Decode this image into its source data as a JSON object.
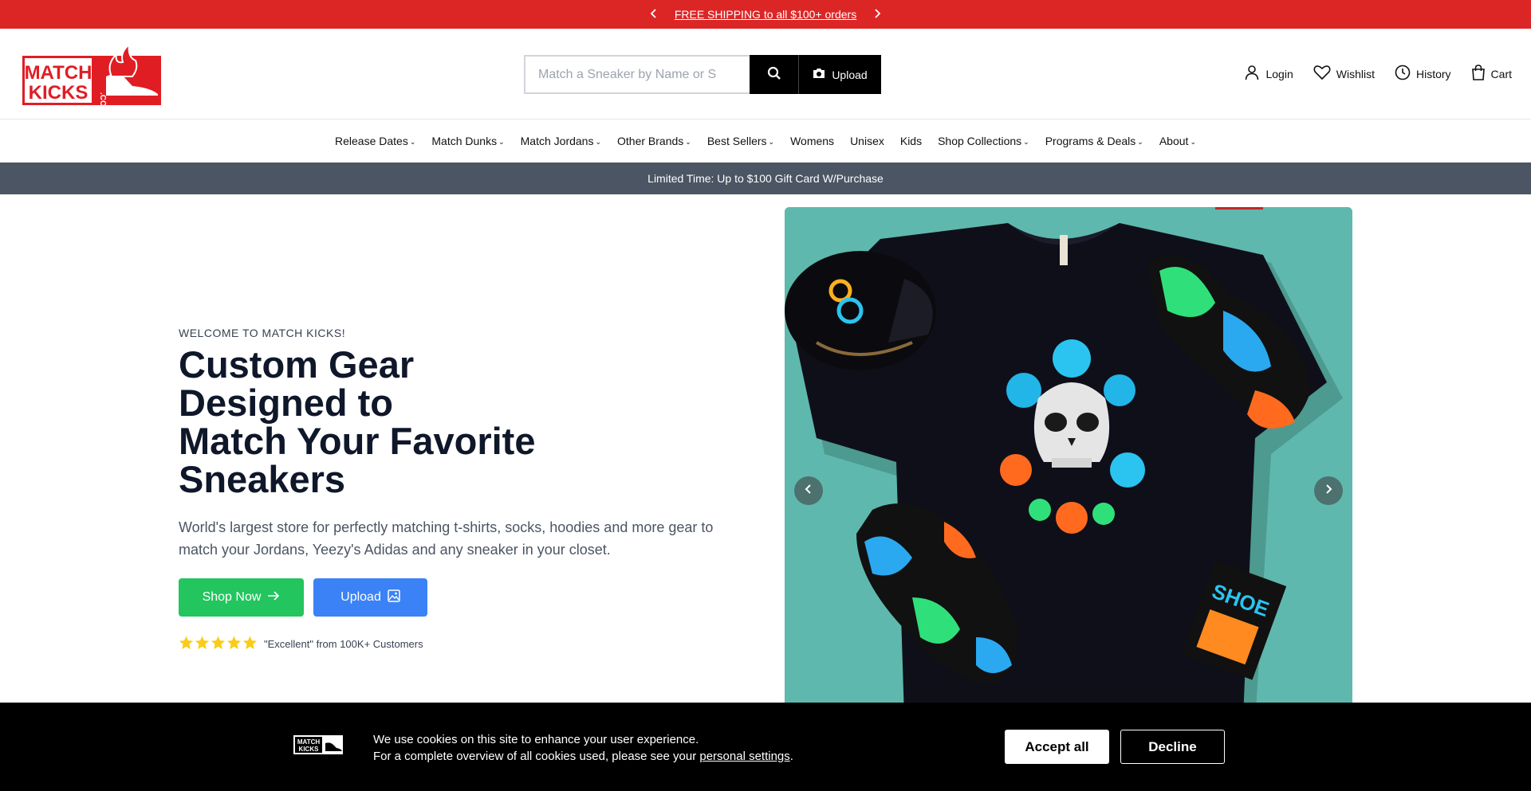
{
  "announcement": {
    "text": "FREE SHIPPING to all $100+ orders",
    "prev_icon": "chevron-left-icon",
    "next_icon": "chevron-right-icon",
    "bg_color": "#dc2626"
  },
  "header": {
    "logo": {
      "line1": "MATCH",
      "line2": "KICKS",
      "suffix": ".COM"
    },
    "search": {
      "placeholder": "Match a Sneaker by Name or S",
      "value": "",
      "upload_label": "Upload"
    },
    "account": [
      {
        "label": "Login",
        "icon": "user-icon"
      },
      {
        "label": "Wishlist",
        "icon": "heart-icon"
      },
      {
        "label": "History",
        "icon": "clock-icon"
      },
      {
        "label": "Cart",
        "icon": "bag-icon"
      }
    ]
  },
  "nav": {
    "items": [
      {
        "label": "Release Dates",
        "dropdown": true
      },
      {
        "label": "Match Dunks",
        "dropdown": true
      },
      {
        "label": "Match Jordans",
        "dropdown": true
      },
      {
        "label": "Other Brands",
        "dropdown": true
      },
      {
        "label": "Best Sellers",
        "dropdown": true
      },
      {
        "label": "Womens",
        "dropdown": false
      },
      {
        "label": "Unisex",
        "dropdown": false
      },
      {
        "label": "Kids",
        "dropdown": false
      },
      {
        "label": "Shop Collections",
        "dropdown": true
      },
      {
        "label": "Programs & Deals",
        "dropdown": true
      },
      {
        "label": "About",
        "dropdown": true
      }
    ]
  },
  "promo": {
    "text": "Limited Time: Up to $100 Gift Card W/Purchase",
    "bg_color": "#4b5563"
  },
  "hero": {
    "eyebrow": "WELCOME TO MATCH KICKS!",
    "title_lines": [
      "Custom Gear",
      "Designed to",
      "Match Your Favorite",
      "Sneakers"
    ],
    "description": "World's largest store for perfectly matching t-shirts, socks, hoodies and more gear to match your Jordans, Yeezy's Adidas and any sneaker in your closet.",
    "shop_now_label": "Shop Now",
    "upload_label": "Upload",
    "rating_text": "\"Excellent\" from 100K+ Customers",
    "rating_stars": 5,
    "colors": {
      "shop_now": "#22c55e",
      "upload": "#3b82f6",
      "stars": "#facc15"
    }
  },
  "slider": {
    "image_alt": "Black skull t-shirt, snapback cap and sneakers on teal background",
    "prev_icon": "chevron-left-icon",
    "next_icon": "chevron-right-icon",
    "shoe_box_text": "SHOE"
  },
  "cookie": {
    "line1": "We use cookies on this site to enhance your user experience.",
    "line2_prefix": "For a complete overview of all cookies used, please see your ",
    "link_text": "personal settings",
    "line2_suffix": ".",
    "accept_label": "Accept all",
    "decline_label": "Decline"
  }
}
